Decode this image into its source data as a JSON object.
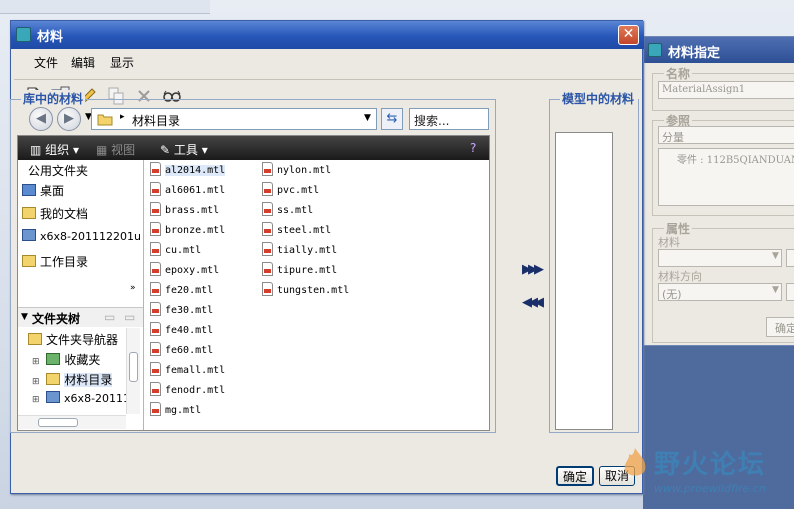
{
  "main_dialog": {
    "title": "材料",
    "menu": [
      "文件",
      "编辑",
      "显示"
    ],
    "library_label": "库中的材料",
    "model_label": "模型中的材料",
    "path": "材料目录",
    "search_placeholder": "搜索...",
    "explorer_toolbar": {
      "organize": "组织",
      "view": "视图",
      "tools": "工具"
    },
    "left_pane": {
      "section_title": "公用文件夹",
      "items": [
        "桌面",
        "我的文档",
        "x6x8-201112201u",
        "工作目录"
      ],
      "tree_header": "文件夹树",
      "tree_items": [
        "文件夹导航器",
        "收藏夹",
        "材料目录",
        "x6x8-20111"
      ]
    },
    "files_col1": [
      "al2014.mtl",
      "al6061.mtl",
      "brass.mtl",
      "bronze.mtl",
      "cu.mtl",
      "epoxy.mtl",
      "fe20.mtl",
      "fe30.mtl",
      "fe40.mtl",
      "fe60.mtl",
      "femall.mtl",
      "fenodr.mtl",
      "mg.mtl"
    ],
    "files_col2": [
      "nylon.mtl",
      "pvc.mtl",
      "ss.mtl",
      "steel.mtl",
      "tially.mtl",
      "tipure.mtl",
      "tungsten.mtl"
    ],
    "selected_file": "al2014.mtl",
    "ok_label": "确定",
    "cancel_label": "取消"
  },
  "assign_dialog": {
    "title": "材料指定",
    "name_label": "名称",
    "name_value": "MaterialAssign1",
    "ref_label": "参照",
    "ref_type": "分量",
    "ref_part": "零件 : 112B5QIANDUAN",
    "props_label": "属性",
    "material_label": "材料",
    "orientation_label": "材料方向",
    "orientation_value": "(无)",
    "ok_label": "确定"
  },
  "watermark": {
    "title": "野火论坛",
    "url": "www.proewildfire.cn"
  }
}
